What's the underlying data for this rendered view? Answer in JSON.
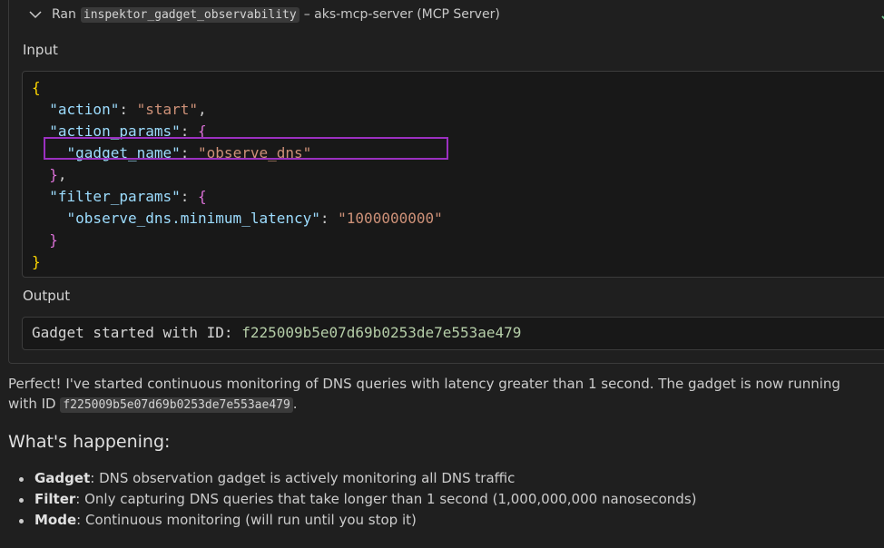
{
  "tool_call": {
    "ran_label": "Ran",
    "tool_name": "inspektor_gadget_observability",
    "server": "– aks-mcp-server (MCP Server)",
    "status_icon": "check-icon",
    "status_color": "#73c991"
  },
  "input": {
    "label": "Input",
    "lines": [
      {
        "t": "{"
      },
      {
        "k": "\"action\"",
        "v": "\"start\"",
        "end": ","
      },
      {
        "k": "\"action_params\"",
        "open": "{"
      },
      {
        "k": "\"gadget_name\"",
        "v": "\"observe_dns\"",
        "indent": 2
      },
      {
        "close": "}",
        "end": ","
      },
      {
        "k": "\"filter_params\"",
        "open": "{"
      },
      {
        "k": "\"observe_dns.minimum_latency\"",
        "v": "\"1000000000\"",
        "indent": 2,
        "highlight": true
      },
      {
        "close": "}"
      },
      {
        "t": "}"
      }
    ],
    "highlight_color": "#9b30c0"
  },
  "output": {
    "label": "Output",
    "prefix": "Gadget started with ID: ",
    "id": "f225009b5e07d69b0253de7e553ae479"
  },
  "message": {
    "text_before": "Perfect! I've started continuous monitoring of DNS queries with latency greater than 1 second. The gadget is now running with ID ",
    "code": "f225009b5e07d69b0253de7e553ae479",
    "text_after": "."
  },
  "heading": "What's happening:",
  "bullets": [
    {
      "term": "Gadget",
      "text": ": DNS observation gadget is actively monitoring all DNS traffic"
    },
    {
      "term": "Filter",
      "text": ": Only capturing DNS queries that take longer than 1 second (1,000,000,000 nanoseconds)"
    },
    {
      "term": "Mode",
      "text": ": Continuous monitoring (will run until you stop it)"
    }
  ]
}
